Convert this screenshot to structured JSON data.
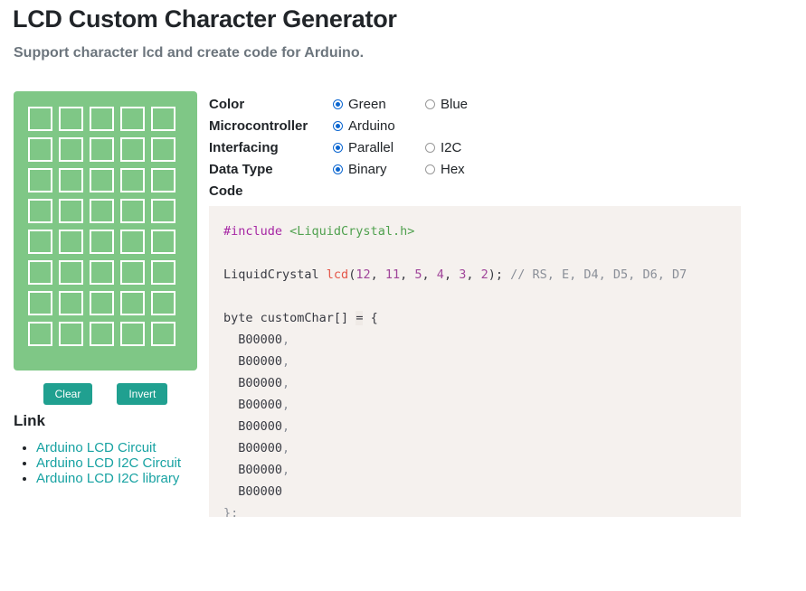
{
  "header": {
    "title": "LCD Custom Character Generator",
    "subtitle": "Support character lcd and create code for Arduino."
  },
  "lcd": {
    "columns": 5,
    "rows": 8,
    "background_color": "#7fc786",
    "cell_border_color": "#ffffff",
    "cells_on": []
  },
  "buttons": {
    "clear_label": "Clear",
    "invert_label": "Invert",
    "color": "#20a090"
  },
  "links_section": {
    "heading": "Link",
    "items": [
      {
        "label": "Arduino LCD Circuit"
      },
      {
        "label": "Arduino LCD I2C Circuit"
      },
      {
        "label": "Arduino LCD I2C library"
      }
    ],
    "link_color": "#17a2a2"
  },
  "options": {
    "rows": [
      {
        "label": "Color",
        "choices": [
          {
            "text": "Green",
            "selected": true
          },
          {
            "text": "Blue",
            "selected": false
          }
        ]
      },
      {
        "label": "Microcontroller",
        "choices": [
          {
            "text": "Arduino",
            "selected": true
          }
        ]
      },
      {
        "label": "Interfacing",
        "choices": [
          {
            "text": "Parallel",
            "selected": true
          },
          {
            "text": "I2C",
            "selected": false
          }
        ]
      },
      {
        "label": "Data Type",
        "choices": [
          {
            "text": "Binary",
            "selected": true
          },
          {
            "text": "Hex",
            "selected": false
          }
        ]
      },
      {
        "label": "Code",
        "choices": []
      }
    ],
    "selected_accent_color": "#0b66d0"
  },
  "code": {
    "background_color": "#f5f1ee",
    "lines": [
      [
        {
          "t": "#include ",
          "c": "tok-pre"
        },
        {
          "t": "<LiquidCrystal.h>",
          "c": "tok-str"
        }
      ],
      [],
      [
        {
          "t": "LiquidCrystal ",
          "c": "tok-plain"
        },
        {
          "t": "lcd",
          "c": "tok-fn"
        },
        {
          "t": "(",
          "c": "tok-plain"
        },
        {
          "t": "12",
          "c": "tok-num"
        },
        {
          "t": ", ",
          "c": "tok-plain"
        },
        {
          "t": "11",
          "c": "tok-num"
        },
        {
          "t": ", ",
          "c": "tok-plain"
        },
        {
          "t": "5",
          "c": "tok-num"
        },
        {
          "t": ", ",
          "c": "tok-plain"
        },
        {
          "t": "4",
          "c": "tok-num"
        },
        {
          "t": ", ",
          "c": "tok-plain"
        },
        {
          "t": "3",
          "c": "tok-num"
        },
        {
          "t": ", ",
          "c": "tok-plain"
        },
        {
          "t": "2",
          "c": "tok-num"
        },
        {
          "t": "); ",
          "c": "tok-plain"
        },
        {
          "t": "// RS, E, D4, D5, D6, D7",
          "c": "tok-cmt"
        }
      ],
      [],
      [
        {
          "t": "byte customChar[] ",
          "c": "tok-plain"
        },
        {
          "t": "=",
          "c": "tok-op"
        },
        {
          "t": " {",
          "c": "tok-plain"
        }
      ],
      [
        {
          "t": "  B00000",
          "c": "tok-plain"
        },
        {
          "t": ",",
          "c": "tok-cmt"
        }
      ],
      [
        {
          "t": "  B00000",
          "c": "tok-plain"
        },
        {
          "t": ",",
          "c": "tok-cmt"
        }
      ],
      [
        {
          "t": "  B00000",
          "c": "tok-plain"
        },
        {
          "t": ",",
          "c": "tok-cmt"
        }
      ],
      [
        {
          "t": "  B00000",
          "c": "tok-plain"
        },
        {
          "t": ",",
          "c": "tok-cmt"
        }
      ],
      [
        {
          "t": "  B00000",
          "c": "tok-plain"
        },
        {
          "t": ",",
          "c": "tok-cmt"
        }
      ],
      [
        {
          "t": "  B00000",
          "c": "tok-plain"
        },
        {
          "t": ",",
          "c": "tok-cmt"
        }
      ],
      [
        {
          "t": "  B00000",
          "c": "tok-plain"
        },
        {
          "t": ",",
          "c": "tok-cmt"
        }
      ],
      [
        {
          "t": "  B00000",
          "c": "tok-plain"
        }
      ],
      [
        {
          "t": "};",
          "c": "tok-cmt"
        }
      ]
    ]
  }
}
